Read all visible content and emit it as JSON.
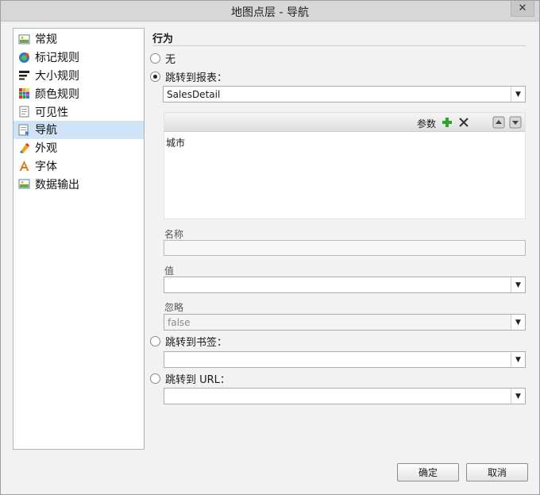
{
  "window": {
    "title": "地图点层 - 导航",
    "close_glyph": "✕"
  },
  "sidebar": {
    "items": [
      {
        "label": "常规",
        "icon": "general-icon"
      },
      {
        "label": "标记规则",
        "icon": "marker-rule-icon"
      },
      {
        "label": "大小规则",
        "icon": "size-rule-icon"
      },
      {
        "label": "颜色规则",
        "icon": "color-rule-icon"
      },
      {
        "label": "可见性",
        "icon": "visibility-icon"
      },
      {
        "label": "导航",
        "icon": "navigation-icon",
        "selected": true
      },
      {
        "label": "外观",
        "icon": "appearance-icon"
      },
      {
        "label": "字体",
        "icon": "font-icon"
      },
      {
        "label": "数据输出",
        "icon": "data-output-icon"
      }
    ]
  },
  "action": {
    "title": "行为",
    "none_label": "无",
    "report_label": "跳转到报表：",
    "report_value": "SalesDetail",
    "params": {
      "toolbar_label": "参数",
      "items": [
        "城市"
      ]
    },
    "name_label": "名称",
    "name_value": "",
    "value_label": "值",
    "value_value": "",
    "omit_label": "忽略",
    "omit_value": "false",
    "bookmark_label": "跳转到书签：",
    "bookmark_value": "",
    "url_label": "跳转到 URL：",
    "url_value": "",
    "selected_option": "report"
  },
  "buttons": {
    "ok": "确定",
    "cancel": "取消"
  },
  "colors": {
    "selection": "#cfe4f7",
    "add": "#2fa52f"
  }
}
